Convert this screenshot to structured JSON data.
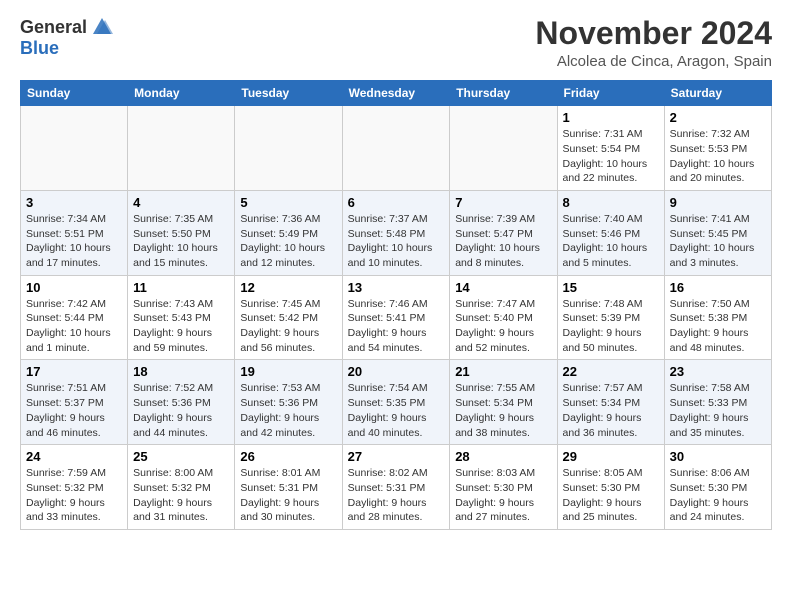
{
  "logo": {
    "general": "General",
    "blue": "Blue"
  },
  "header": {
    "month": "November 2024",
    "location": "Alcolea de Cinca, Aragon, Spain"
  },
  "days_of_week": [
    "Sunday",
    "Monday",
    "Tuesday",
    "Wednesday",
    "Thursday",
    "Friday",
    "Saturday"
  ],
  "weeks": [
    [
      {
        "day": "",
        "info": ""
      },
      {
        "day": "",
        "info": ""
      },
      {
        "day": "",
        "info": ""
      },
      {
        "day": "",
        "info": ""
      },
      {
        "day": "",
        "info": ""
      },
      {
        "day": "1",
        "info": "Sunrise: 7:31 AM\nSunset: 5:54 PM\nDaylight: 10 hours\nand 22 minutes."
      },
      {
        "day": "2",
        "info": "Sunrise: 7:32 AM\nSunset: 5:53 PM\nDaylight: 10 hours\nand 20 minutes."
      }
    ],
    [
      {
        "day": "3",
        "info": "Sunrise: 7:34 AM\nSunset: 5:51 PM\nDaylight: 10 hours\nand 17 minutes."
      },
      {
        "day": "4",
        "info": "Sunrise: 7:35 AM\nSunset: 5:50 PM\nDaylight: 10 hours\nand 15 minutes."
      },
      {
        "day": "5",
        "info": "Sunrise: 7:36 AM\nSunset: 5:49 PM\nDaylight: 10 hours\nand 12 minutes."
      },
      {
        "day": "6",
        "info": "Sunrise: 7:37 AM\nSunset: 5:48 PM\nDaylight: 10 hours\nand 10 minutes."
      },
      {
        "day": "7",
        "info": "Sunrise: 7:39 AM\nSunset: 5:47 PM\nDaylight: 10 hours\nand 8 minutes."
      },
      {
        "day": "8",
        "info": "Sunrise: 7:40 AM\nSunset: 5:46 PM\nDaylight: 10 hours\nand 5 minutes."
      },
      {
        "day": "9",
        "info": "Sunrise: 7:41 AM\nSunset: 5:45 PM\nDaylight: 10 hours\nand 3 minutes."
      }
    ],
    [
      {
        "day": "10",
        "info": "Sunrise: 7:42 AM\nSunset: 5:44 PM\nDaylight: 10 hours\nand 1 minute."
      },
      {
        "day": "11",
        "info": "Sunrise: 7:43 AM\nSunset: 5:43 PM\nDaylight: 9 hours\nand 59 minutes."
      },
      {
        "day": "12",
        "info": "Sunrise: 7:45 AM\nSunset: 5:42 PM\nDaylight: 9 hours\nand 56 minutes."
      },
      {
        "day": "13",
        "info": "Sunrise: 7:46 AM\nSunset: 5:41 PM\nDaylight: 9 hours\nand 54 minutes."
      },
      {
        "day": "14",
        "info": "Sunrise: 7:47 AM\nSunset: 5:40 PM\nDaylight: 9 hours\nand 52 minutes."
      },
      {
        "day": "15",
        "info": "Sunrise: 7:48 AM\nSunset: 5:39 PM\nDaylight: 9 hours\nand 50 minutes."
      },
      {
        "day": "16",
        "info": "Sunrise: 7:50 AM\nSunset: 5:38 PM\nDaylight: 9 hours\nand 48 minutes."
      }
    ],
    [
      {
        "day": "17",
        "info": "Sunrise: 7:51 AM\nSunset: 5:37 PM\nDaylight: 9 hours\nand 46 minutes."
      },
      {
        "day": "18",
        "info": "Sunrise: 7:52 AM\nSunset: 5:36 PM\nDaylight: 9 hours\nand 44 minutes."
      },
      {
        "day": "19",
        "info": "Sunrise: 7:53 AM\nSunset: 5:36 PM\nDaylight: 9 hours\nand 42 minutes."
      },
      {
        "day": "20",
        "info": "Sunrise: 7:54 AM\nSunset: 5:35 PM\nDaylight: 9 hours\nand 40 minutes."
      },
      {
        "day": "21",
        "info": "Sunrise: 7:55 AM\nSunset: 5:34 PM\nDaylight: 9 hours\nand 38 minutes."
      },
      {
        "day": "22",
        "info": "Sunrise: 7:57 AM\nSunset: 5:34 PM\nDaylight: 9 hours\nand 36 minutes."
      },
      {
        "day": "23",
        "info": "Sunrise: 7:58 AM\nSunset: 5:33 PM\nDaylight: 9 hours\nand 35 minutes."
      }
    ],
    [
      {
        "day": "24",
        "info": "Sunrise: 7:59 AM\nSunset: 5:32 PM\nDaylight: 9 hours\nand 33 minutes."
      },
      {
        "day": "25",
        "info": "Sunrise: 8:00 AM\nSunset: 5:32 PM\nDaylight: 9 hours\nand 31 minutes."
      },
      {
        "day": "26",
        "info": "Sunrise: 8:01 AM\nSunset: 5:31 PM\nDaylight: 9 hours\nand 30 minutes."
      },
      {
        "day": "27",
        "info": "Sunrise: 8:02 AM\nSunset: 5:31 PM\nDaylight: 9 hours\nand 28 minutes."
      },
      {
        "day": "28",
        "info": "Sunrise: 8:03 AM\nSunset: 5:30 PM\nDaylight: 9 hours\nand 27 minutes."
      },
      {
        "day": "29",
        "info": "Sunrise: 8:05 AM\nSunset: 5:30 PM\nDaylight: 9 hours\nand 25 minutes."
      },
      {
        "day": "30",
        "info": "Sunrise: 8:06 AM\nSunset: 5:30 PM\nDaylight: 9 hours\nand 24 minutes."
      }
    ]
  ]
}
